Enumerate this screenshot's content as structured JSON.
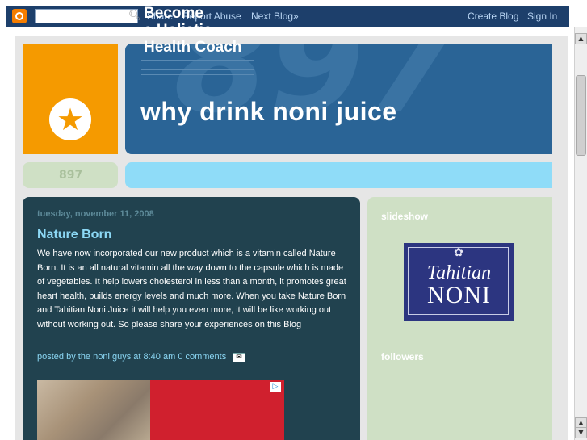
{
  "navbar": {
    "search_placeholder": "",
    "share": "Share",
    "report_abuse": "Report Abuse",
    "next_blog": "Next Blog»",
    "create_blog": "Create Blog",
    "sign_in": "Sign In"
  },
  "header": {
    "title": "why drink noni juice",
    "big_number": "897",
    "strip_number": "897"
  },
  "post": {
    "date": "tuesday, november 11, 2008",
    "title": "Nature Born",
    "body": "We have now incorporated our new product which is a vitamin called Nature Born. It is an all natural vitamin all the way down to the capsule which is made of vegetables. It help lowers cholesterol in less than a month, it promotes great heart health, builds energy levels and much more. When you take Nature Born and Tahitian Noni Juice it will help you even more, it will be like working out without working out. So please share your experiences on this Blog",
    "posted_by": "posted by the noni guys at",
    "time": "8:40 am",
    "comments": "0 comments"
  },
  "ad": {
    "headline": "Become\na Holistic\nHealth Coach"
  },
  "sidebar": {
    "slideshow_title": "slideshow",
    "followers_title": "followers",
    "logo_line1": "Tahitian",
    "logo_line2": "NONI"
  },
  "colors": {
    "navbar": "#1d3f6b",
    "orange": "#f59a00",
    "header_blue": "#2a6496",
    "post_bg": "#21424f",
    "sidebar_bg": "#cfe0c5",
    "link": "#8cd8f5"
  }
}
